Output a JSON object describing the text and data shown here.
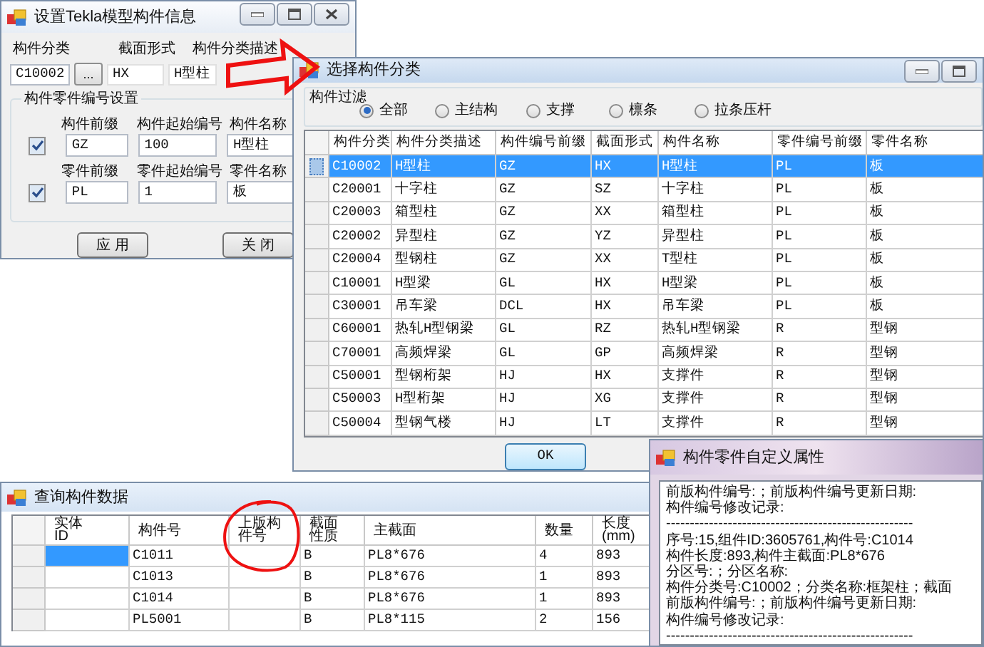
{
  "settings_window": {
    "title": "设置Tekla模型构件信息",
    "header_labels": [
      "构件分类",
      "截面形式",
      "构件分类描述"
    ],
    "category_code": "C10002",
    "browse_button": "...",
    "section_type": "HX",
    "category_description": "H型柱",
    "numbering_group": {
      "title": "构件零件编号设置",
      "rows": [
        {
          "checked": true,
          "labels": [
            "构件前缀",
            "构件起始编号",
            "构件名称"
          ],
          "values": [
            "GZ",
            "100",
            "H型柱"
          ]
        },
        {
          "checked": true,
          "labels": [
            "零件前缀",
            "零件起始编号",
            "零件名称"
          ],
          "values": [
            "PL",
            "1",
            "板"
          ]
        }
      ]
    },
    "buttons": [
      "应 用",
      "关 闭"
    ]
  },
  "category_dialog": {
    "title": "选择构件分类",
    "filter": {
      "title": "构件过滤",
      "options": [
        {
          "label": "全部",
          "selected": true
        },
        {
          "label": "主结构",
          "selected": false
        },
        {
          "label": "支撑",
          "selected": false
        },
        {
          "label": "檩条",
          "selected": false
        },
        {
          "label": "拉条压杆",
          "selected": false
        }
      ]
    },
    "table": {
      "columns": [
        "构件分类",
        "构件分类描述",
        "构件编号前缀",
        "截面形式",
        "构件名称",
        "零件编号前缀",
        "零件名称"
      ],
      "rows": [
        {
          "cells": [
            "C10002",
            "H型柱",
            "GZ",
            "HX",
            "H型柱",
            "PL",
            "板"
          ],
          "selected": true
        },
        {
          "cells": [
            "C20001",
            "十字柱",
            "GZ",
            "SZ",
            "十字柱",
            "PL",
            "板"
          ],
          "selected": false
        },
        {
          "cells": [
            "C20003",
            "箱型柱",
            "GZ",
            "XX",
            "箱型柱",
            "PL",
            "板"
          ],
          "selected": false
        },
        {
          "cells": [
            "C20002",
            "异型柱",
            "GZ",
            "YZ",
            "异型柱",
            "PL",
            "板"
          ],
          "selected": false
        },
        {
          "cells": [
            "C20004",
            "型钢柱",
            "GZ",
            "XX",
            "T型柱",
            "PL",
            "板"
          ],
          "selected": false
        },
        {
          "cells": [
            "C10001",
            "H型梁",
            "GL",
            "HX",
            "H型梁",
            "PL",
            "板"
          ],
          "selected": false
        },
        {
          "cells": [
            "C30001",
            "吊车梁",
            "DCL",
            "HX",
            "吊车梁",
            "PL",
            "板"
          ],
          "selected": false
        },
        {
          "cells": [
            "C60001",
            "热轧H型钢梁",
            "GL",
            "RZ",
            "热轧H型钢梁",
            "R",
            "型钢"
          ],
          "selected": false
        },
        {
          "cells": [
            "C70001",
            "高频焊梁",
            "GL",
            "GP",
            "高频焊梁",
            "R",
            "型钢"
          ],
          "selected": false
        },
        {
          "cells": [
            "C50001",
            "型钢桁架",
            "HJ",
            "HX",
            "支撑件",
            "R",
            "型钢"
          ],
          "selected": false
        },
        {
          "cells": [
            "C50003",
            "H型桁架",
            "HJ",
            "XG",
            "支撑件",
            "R",
            "型钢"
          ],
          "selected": false
        },
        {
          "cells": [
            "C50004",
            "型钢气楼",
            "HJ",
            "LT",
            "支撑件",
            "R",
            "型钢"
          ],
          "selected": false
        }
      ]
    },
    "ok_button": "OK"
  },
  "query_window": {
    "title": "查询构件数据",
    "table": {
      "columns": [
        "实体ID",
        "构件号",
        "上版构件号",
        "截面性质",
        "主截面",
        "数量",
        "长度(mm)"
      ],
      "rows": [
        {
          "part_no": "C1011",
          "section_property": "B",
          "main_section": "PL8*676",
          "quantity": "4",
          "length": "893",
          "id_cell_selected": true
        },
        {
          "part_no": "C1013",
          "section_property": "B",
          "main_section": "PL8*676",
          "quantity": "1",
          "length": "893",
          "id_cell_selected": false
        },
        {
          "part_no": "C1014",
          "section_property": "B",
          "main_section": "PL8*676",
          "quantity": "1",
          "length": "893",
          "id_cell_selected": false
        },
        {
          "part_no": "PL5001",
          "section_property": "B",
          "main_section": "PL8*115",
          "quantity": "2",
          "length": "156",
          "id_cell_selected": false
        }
      ]
    }
  },
  "properties_window": {
    "title": "构件零件自定义属性",
    "lines": [
      "前版构件编号:；前版构件编号更新日期:",
      "构件编号修改记录:",
      "----------------------------------------------------",
      "序号:15,组件ID:3605761,构件号:C1014",
      "构件长度:893,构件主截面:PL8*676",
      "分区号:；分区名称:",
      "构件分类号:C10002；分类名称:框架柱；截面",
      "前版构件编号:；前版构件编号更新日期:",
      "构件编号修改记录:",
      "----------------------------------------------------"
    ]
  }
}
